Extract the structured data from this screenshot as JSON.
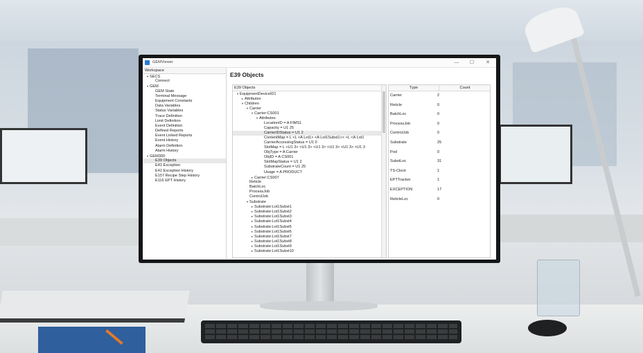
{
  "window": {
    "title": "GEMViewer",
    "minimize_glyph": "—",
    "maximize_glyph": "☐",
    "close_glyph": "✕"
  },
  "sidebar": {
    "header": "Workspace",
    "items": [
      {
        "label": "SECS",
        "depth": 1,
        "caret": "▾"
      },
      {
        "label": "Connect",
        "depth": 3,
        "caret": ""
      },
      {
        "label": "GEM",
        "depth": 1,
        "caret": "▾"
      },
      {
        "label": "GEM State",
        "depth": 3,
        "caret": ""
      },
      {
        "label": "Terminal Message",
        "depth": 3,
        "caret": ""
      },
      {
        "label": "Equipment Constants",
        "depth": 3,
        "caret": ""
      },
      {
        "label": "Data Variables",
        "depth": 3,
        "caret": ""
      },
      {
        "label": "Status Variables",
        "depth": 3,
        "caret": ""
      },
      {
        "label": "Trace Definition",
        "depth": 3,
        "caret": ""
      },
      {
        "label": "Limit Definition",
        "depth": 3,
        "caret": ""
      },
      {
        "label": "Event Definition",
        "depth": 3,
        "caret": ""
      },
      {
        "label": "Defined Reports",
        "depth": 3,
        "caret": ""
      },
      {
        "label": "Event Linked Reports",
        "depth": 3,
        "caret": ""
      },
      {
        "label": "Event History",
        "depth": 3,
        "caret": ""
      },
      {
        "label": "Alarm Definition",
        "depth": 3,
        "caret": ""
      },
      {
        "label": "Alarm History",
        "depth": 3,
        "caret": ""
      },
      {
        "label": "GEM300",
        "depth": 1,
        "caret": "▾"
      },
      {
        "label": "E39 Objects",
        "depth": 3,
        "caret": "",
        "selected": true
      },
      {
        "label": "E41 Exception",
        "depth": 3,
        "caret": ""
      },
      {
        "label": "E41 Exception History",
        "depth": 3,
        "caret": ""
      },
      {
        "label": "E157 Recipe Step History",
        "depth": 3,
        "caret": ""
      },
      {
        "label": "E116 EPT History",
        "depth": 3,
        "caret": ""
      }
    ]
  },
  "main": {
    "title": "E39 Objects",
    "tree": {
      "header": "E39 Objects",
      "rows": [
        {
          "label": "EquipmentDeviceID1",
          "depth": 1,
          "caret": "▾"
        },
        {
          "label": "Attributes",
          "depth": 2,
          "caret": "▸"
        },
        {
          "label": "Children",
          "depth": 2,
          "caret": "▾"
        },
        {
          "label": "Carrier",
          "depth": 3,
          "caret": "▾"
        },
        {
          "label": "Carrier:CS001",
          "depth": 4,
          "caret": "▾"
        },
        {
          "label": "Attributes",
          "depth": 5,
          "caret": "▾"
        },
        {
          "label": "LocationID = A FIMS1",
          "depth": 6,
          "caret": ""
        },
        {
          "label": "Capacity = U1 25",
          "depth": 6,
          "caret": ""
        },
        {
          "label": "CarrierIDStatus = U1 2",
          "depth": 6,
          "caret": "",
          "selected": true
        },
        {
          "label": "ContentMap = L <L <A Lot1> <A Lot1Subst1>> <L <A Lot1",
          "depth": 6,
          "caret": ""
        },
        {
          "label": "CarrierAccessingStatus = U1 0",
          "depth": 6,
          "caret": ""
        },
        {
          "label": "SlotMap = L <U1 3> <U1 3> <U1 3> <U1 3> <U1 3> <U1 3",
          "depth": 6,
          "caret": ""
        },
        {
          "label": "ObjType = A Carrier",
          "depth": 6,
          "caret": ""
        },
        {
          "label": "ObjID = A CS001",
          "depth": 6,
          "caret": ""
        },
        {
          "label": "SlotMapStatus = U1 2",
          "depth": 6,
          "caret": ""
        },
        {
          "label": "SubstrateCount = U1 25",
          "depth": 6,
          "caret": ""
        },
        {
          "label": "Usage = A PRODUCT",
          "depth": 6,
          "caret": ""
        },
        {
          "label": "Carrier:CS007",
          "depth": 4,
          "caret": "▸"
        },
        {
          "label": "Reticle",
          "depth": 3,
          "caret": ""
        },
        {
          "label": "BatchLoc",
          "depth": 3,
          "caret": ""
        },
        {
          "label": "ProcessJob",
          "depth": 3,
          "caret": ""
        },
        {
          "label": "ControlJob",
          "depth": 3,
          "caret": ""
        },
        {
          "label": "Substrate",
          "depth": 3,
          "caret": "▾"
        },
        {
          "label": "Substrate:Lot1Subst1",
          "depth": 4,
          "caret": "▸"
        },
        {
          "label": "Substrate:Lot1Subst2",
          "depth": 4,
          "caret": "▸"
        },
        {
          "label": "Substrate:Lot1Subst3",
          "depth": 4,
          "caret": "▸"
        },
        {
          "label": "Substrate:Lot1Subst4",
          "depth": 4,
          "caret": "▸"
        },
        {
          "label": "Substrate:Lot1Subst5",
          "depth": 4,
          "caret": "▸"
        },
        {
          "label": "Substrate:Lot1Subst6",
          "depth": 4,
          "caret": "▸"
        },
        {
          "label": "Substrate:Lot1Subst7",
          "depth": 4,
          "caret": "▸"
        },
        {
          "label": "Substrate:Lot1Subst8",
          "depth": 4,
          "caret": "▸"
        },
        {
          "label": "Substrate:Lot1Subst9",
          "depth": 4,
          "caret": "▸"
        },
        {
          "label": "Substrate:Lot1Subst10",
          "depth": 4,
          "caret": "▸"
        }
      ]
    },
    "type_table": {
      "col_type": "Type",
      "col_count": "Count",
      "rows": [
        {
          "type": "Carrier",
          "count": "2"
        },
        {
          "type": "Reticle",
          "count": "0"
        },
        {
          "type": "BatchLoc",
          "count": "0"
        },
        {
          "type": "ProcessJob",
          "count": "0"
        },
        {
          "type": "ControlJob",
          "count": "0"
        },
        {
          "type": "Substrate",
          "count": "25"
        },
        {
          "type": "Pod",
          "count": "0"
        },
        {
          "type": "SubstLoc",
          "count": "31"
        },
        {
          "type": "TS-Clock",
          "count": "1"
        },
        {
          "type": "EPTTracker",
          "count": "1"
        },
        {
          "type": "EXCEPTION",
          "count": "17"
        },
        {
          "type": "ReticleLoc",
          "count": "0"
        }
      ]
    }
  }
}
